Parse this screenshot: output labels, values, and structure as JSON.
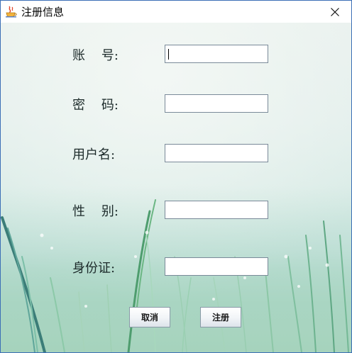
{
  "window": {
    "title": "注册信息",
    "icon": "java-app-icon",
    "close_icon": "close-icon"
  },
  "form": {
    "fields": [
      {
        "label": "账    号:",
        "value": "",
        "focused": true
      },
      {
        "label": "密    码:",
        "value": ""
      },
      {
        "label": "用户名:",
        "value": ""
      },
      {
        "label": "性    别:",
        "value": ""
      },
      {
        "label": "身份证:",
        "value": ""
      }
    ]
  },
  "buttons": {
    "cancel_label": "取消",
    "register_label": "注册"
  },
  "colors": {
    "frame_border": "#3c6fb6",
    "background_top": "#e9f1ee",
    "background_grass": "#8fc9a8"
  }
}
